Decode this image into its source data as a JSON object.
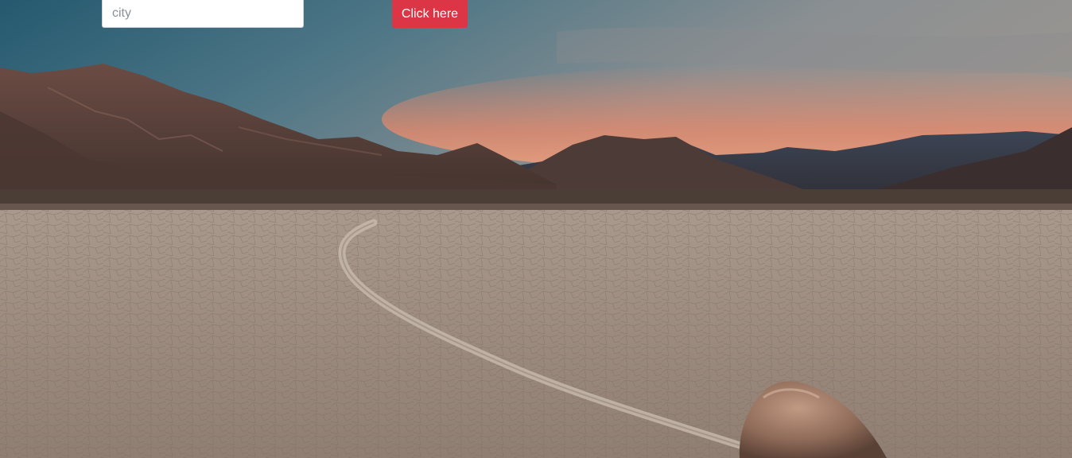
{
  "search": {
    "placeholder": "city",
    "value": ""
  },
  "actions": {
    "submit_label": "Click here"
  },
  "colors": {
    "button": "#dc3545",
    "input_border": "#ced4da"
  },
  "background": {
    "icon": "desert-landscape-image"
  }
}
